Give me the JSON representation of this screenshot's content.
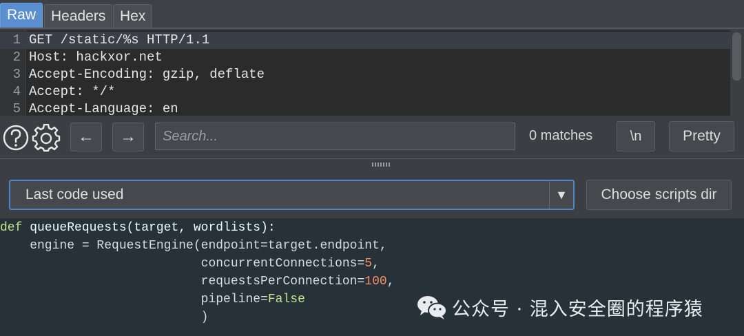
{
  "tabs": [
    {
      "label": "Raw",
      "active": true
    },
    {
      "label": "Headers",
      "active": false
    },
    {
      "label": "Hex",
      "active": false
    }
  ],
  "request_lines": [
    {
      "n": "1",
      "text": "GET /static/%s HTTP/1.1"
    },
    {
      "n": "2",
      "text": "Host: hackxor.net"
    },
    {
      "n": "3",
      "text": "Accept-Encoding: gzip, deflate"
    },
    {
      "n": "4",
      "text": "Accept: */*"
    },
    {
      "n": "5",
      "text": "Accept-Language: en"
    }
  ],
  "toolbar": {
    "help_icon": "question-circle-icon",
    "settings_icon": "gear-icon",
    "back_label": "←",
    "forward_label": "→",
    "search_placeholder": "Search...",
    "matches": "0 matches",
    "newline_label": "\\n",
    "pretty_label": "Pretty"
  },
  "script_selector": {
    "selected": "Last code used",
    "arrow": "▼",
    "choose_dir_label": "Choose scripts dir"
  },
  "code": {
    "l1": {
      "kw": "def",
      "rest": " queueRequests(target, wordlists):"
    },
    "l2": {
      "text": "    engine = RequestEngine(endpoint=target.endpoint,"
    },
    "l3": {
      "pre": "                           concurrentConnections=",
      "num": "5",
      "post": ","
    },
    "l4": {
      "pre": "                           requestsPerConnection=",
      "num": "100",
      "post": ","
    },
    "l5": {
      "pre": "                           pipeline=",
      "bool": "False"
    },
    "l6": {
      "text": "                           )"
    }
  },
  "watermark": {
    "text": "公众号 · 混入安全圈的程序猿",
    "icon": "wechat-icon"
  },
  "colors": {
    "accent": "#5b8fd0",
    "editor_bg": "#2b2b2b",
    "code_bg": "#263238",
    "keyword": "#c3e88d",
    "number": "#f78c6c"
  }
}
